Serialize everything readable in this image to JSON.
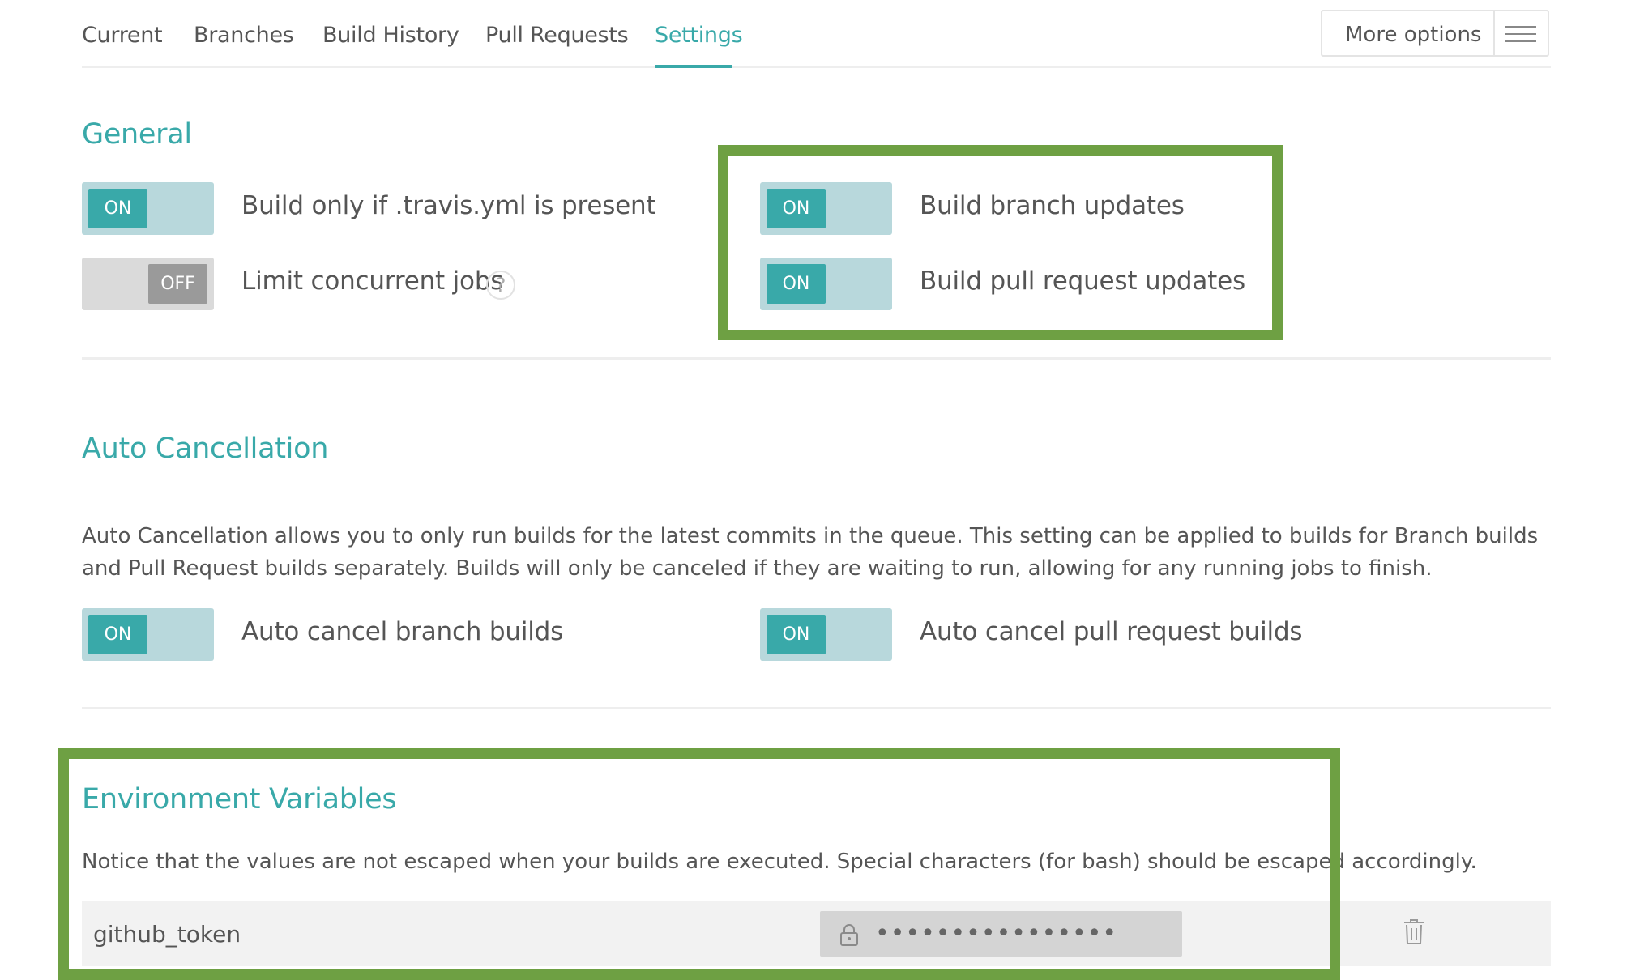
{
  "tabs": [
    {
      "label": "Current",
      "active": false
    },
    {
      "label": "Branches",
      "active": false
    },
    {
      "label": "Build History",
      "active": false
    },
    {
      "label": "Pull Requests",
      "active": false
    },
    {
      "label": "Settings",
      "active": true
    }
  ],
  "more_options": {
    "label": "More options",
    "icon": "hamburger-menu-icon"
  },
  "general": {
    "heading": "General",
    "settings": [
      {
        "label": "Build only if .travis.yml is present",
        "state": "ON"
      },
      {
        "label": "Limit concurrent jobs",
        "state": "OFF",
        "help": "?"
      },
      {
        "label": "Build branch updates",
        "state": "ON"
      },
      {
        "label": "Build pull request updates",
        "state": "ON"
      }
    ]
  },
  "auto_cancellation": {
    "heading": "Auto Cancellation",
    "description": "Auto Cancellation allows you to only run builds for the latest commits in the queue. This setting can be applied to builds for Branch builds and Pull Request builds separately. Builds will only be canceled if they are waiting to run, allowing for any running jobs to finish.",
    "settings": [
      {
        "label": "Auto cancel branch builds",
        "state": "ON"
      },
      {
        "label": "Auto cancel pull request builds",
        "state": "ON"
      }
    ]
  },
  "env_vars": {
    "heading": "Environment Variables",
    "notice": "Notice that the values are not escaped when your builds are executed. Special characters (for bash) should be escaped accordingly.",
    "rows": [
      {
        "name": "github_token",
        "value": "••••••••••••••••",
        "icons": [
          "lock-icon",
          "trash-icon"
        ]
      }
    ]
  },
  "colors": {
    "accent": "#39a9a9",
    "toggle_on_track": "#b8d8dc",
    "toggle_off_track": "#dadada",
    "highlight": "#6ea043"
  }
}
